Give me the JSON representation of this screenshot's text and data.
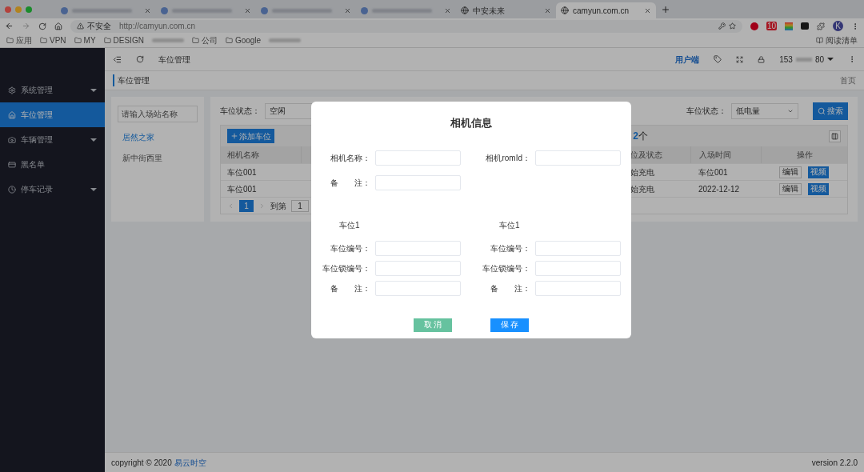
{
  "browser": {
    "tabs": [
      {
        "kind": "blurred",
        "selected": false
      },
      {
        "kind": "blurred",
        "selected": false
      },
      {
        "kind": "blurred",
        "selected": false
      },
      {
        "kind": "blurred",
        "selected": false
      },
      {
        "kind": "titled",
        "title": "中安未来",
        "selected": false
      },
      {
        "kind": "titled",
        "title": "camyun.com.cn",
        "selected": true
      }
    ],
    "security": "不安全",
    "url": "http://camyun.com.cn",
    "extension_badge": "10",
    "avatar": "K",
    "bookmarks": [
      {
        "kind": "text",
        "label": "应用"
      },
      {
        "kind": "text",
        "label": "VPN"
      },
      {
        "kind": "text",
        "label": "MY"
      },
      {
        "kind": "text",
        "label": "DESIGN"
      },
      {
        "kind": "blurred"
      },
      {
        "kind": "text",
        "label": "公司"
      },
      {
        "kind": "text",
        "label": "Google"
      },
      {
        "kind": "blurred"
      }
    ],
    "reading_list": "阅读清单"
  },
  "header": {
    "tab": "车位管理",
    "user_link": "用户端",
    "phone_start": "153",
    "phone_end": "80"
  },
  "breadcrumb": "车位管理",
  "home_link": "首页",
  "sidebar": {
    "items": [
      {
        "label": "系统管理",
        "expandable": true,
        "selected": false
      },
      {
        "label": "车位管理",
        "expandable": false,
        "selected": true
      },
      {
        "label": "车辆管理",
        "expandable": true,
        "selected": false
      },
      {
        "label": "黑名单",
        "expandable": false,
        "selected": false
      },
      {
        "label": "停车记录",
        "expandable": true,
        "selected": false
      }
    ]
  },
  "stations": {
    "placeholder": "请输入场站名称",
    "items": [
      {
        "label": "居然之家",
        "selected": true
      },
      {
        "label": "新中街西里",
        "selected": false
      }
    ]
  },
  "filters": [
    {
      "label": "车位状态：",
      "value": "空闲"
    },
    {
      "label": "车位状态：",
      "value": "低电量"
    }
  ],
  "search_button": "搜索",
  "add_button": "添加车位",
  "count": "2",
  "count_suffix": "个",
  "table": {
    "columns": [
      "相机名称",
      "位及状态",
      "入场时间",
      "操作"
    ],
    "rows": [
      {
        "cells": [
          "车位001",
          "始充电",
          "车位001"
        ],
        "actions": [
          "编辑",
          "视频"
        ]
      },
      {
        "cells": [
          "车位001",
          "始充电",
          "2022-12-12"
        ],
        "actions": [
          "编辑",
          "视频"
        ]
      }
    ]
  },
  "pagination": {
    "page": "1",
    "goto_label": "到第",
    "goto_value": "1"
  },
  "footer": {
    "copyright": "copyright © 2020",
    "company": "易云时空",
    "version": "version 2.2.0"
  },
  "modal": {
    "title": "相机信息",
    "fields": [
      {
        "label": "相机名称："
      },
      {
        "label": "相机romId："
      },
      {
        "label": "备　　注："
      }
    ],
    "sections": [
      {
        "title": "车位1",
        "fields": [
          {
            "label": "车位编号："
          },
          {
            "label": "车位锁编号："
          },
          {
            "label": "备　　注："
          }
        ]
      },
      {
        "title": "车位1",
        "fields": [
          {
            "label": "车位编号："
          },
          {
            "label": "车位锁编号："
          },
          {
            "label": "备　　注："
          }
        ]
      }
    ],
    "buttons": [
      {
        "label": "取 消",
        "kind": "cancel"
      },
      {
        "label": "保 存",
        "kind": "primary"
      }
    ]
  }
}
